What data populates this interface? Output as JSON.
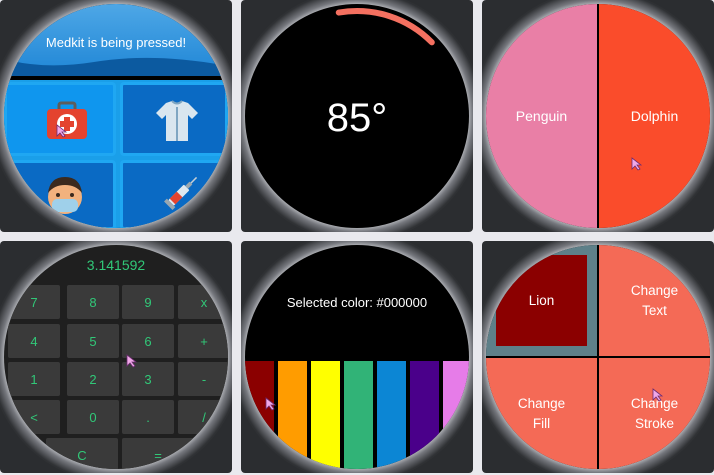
{
  "panels": {
    "medkit": {
      "message": "Medkit is being pressed!",
      "tiles": [
        "medkit-icon",
        "shirt-icon",
        "face-mask-icon",
        "syringe-icon"
      ]
    },
    "temperature": {
      "value": "85°",
      "arc_fraction": 0.28,
      "arc_color": "#f47060"
    },
    "animals": {
      "left": {
        "label": "Penguin",
        "color": "#e97fa6"
      },
      "right": {
        "label": "Dolphin",
        "color": "#fa4c2b"
      }
    },
    "calculator": {
      "display": "3.141592",
      "rows": [
        [
          "7",
          "8",
          "9",
          "x"
        ],
        [
          "4",
          "5",
          "6",
          "+"
        ],
        [
          "1",
          "2",
          "3",
          "-"
        ],
        [
          "<",
          "0",
          ".",
          "/"
        ],
        [
          "C",
          "="
        ]
      ]
    },
    "color_picker": {
      "label": "Selected color: #000000",
      "colors": [
        "#8b0000",
        "#ff9c00",
        "#ffff00",
        "#31b377",
        "#0c86d4",
        "#4a008a",
        "#e67ce8"
      ]
    },
    "shape_editor": {
      "lion": "Lion",
      "change_text": [
        "Change",
        "Text"
      ],
      "change_fill": [
        "Change",
        "Fill"
      ],
      "change_stroke": [
        "Change",
        "Stroke"
      ],
      "lion_fill": "#8b0000",
      "lion_stroke": "#5e8089",
      "button_color": "#f46a56"
    }
  }
}
